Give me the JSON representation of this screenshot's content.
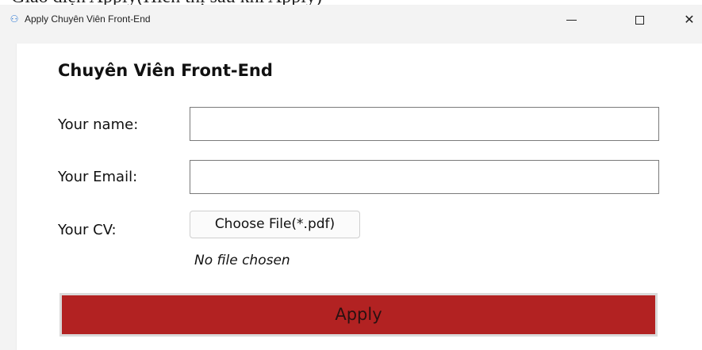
{
  "top_fragment": {
    "text": "Giao diện Apply(Hiển thị sau khi Apply)"
  },
  "window": {
    "title": "Apply Chuyên Viên Front-End",
    "icon": "person-icon",
    "controls": {
      "minimize_icon": "minimize-icon",
      "maximize_icon": "maximize-icon",
      "close_icon": "close-icon"
    }
  },
  "form": {
    "job_title": "Chuyên Viên Front-End",
    "name": {
      "label": "Your name:",
      "value": "",
      "placeholder": ""
    },
    "email": {
      "label": "Your Email:",
      "value": "",
      "placeholder": ""
    },
    "cv": {
      "label": "Your CV:",
      "button_label": "Choose File(*.pdf)",
      "status": "No file chosen"
    },
    "apply_label": "Apply"
  },
  "colors": {
    "apply_background": "#b22222",
    "window_background": "#f3f3f3",
    "content_background": "#ffffff"
  }
}
